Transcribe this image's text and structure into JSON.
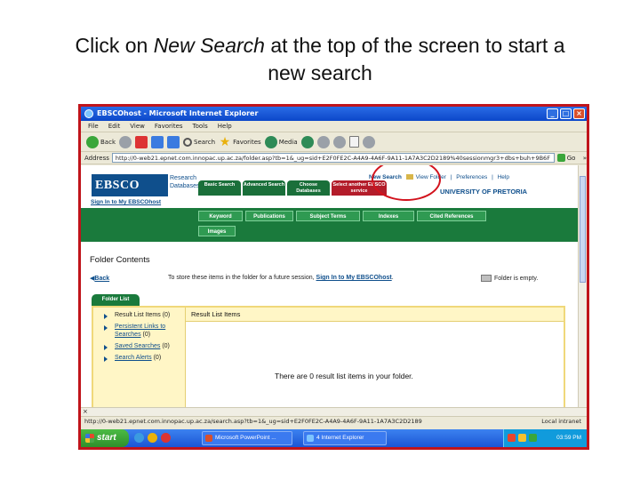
{
  "slide": {
    "title_part1": "Click on ",
    "title_emph": "New Search",
    "title_part2": " at the top of the screen to start a",
    "title_line2": "new search"
  },
  "window": {
    "title": "EBSCOhost - Microsoft Internet Explorer",
    "btn_min": "_",
    "btn_max": "□",
    "btn_close": "×"
  },
  "menu": [
    "File",
    "Edit",
    "View",
    "Favorites",
    "Tools",
    "Help"
  ],
  "toolbar": {
    "back": "Back",
    "search": "Search",
    "favorites": "Favorites",
    "media": "Media"
  },
  "address": {
    "label": "Address",
    "url": "http://0-web21.epnet.com.innopac.up.ac.za/folder.asp?tb=1&_ug=sid+E2F0FE2C-A4A9-4A6F-9A11-1A7A3C2D2189%40sessionmgr3+dbs+buh+9B6F",
    "go": "Go",
    "links": "»"
  },
  "ebsco": {
    "logo": "EBSCO",
    "logo_sub1": "Research",
    "logo_sub2": "Databases",
    "signin": "Sign In to My EBSCOhost",
    "tabs": [
      "Basic Search",
      "Advanced Search",
      "Choose Databases"
    ],
    "tab_select": "Select another EBSCO service",
    "new_search": "New Search",
    "view_folder": "View Folder",
    "preferences": "Preferences",
    "help": "Help",
    "sep": "|",
    "university": "UNIVERSITY OF PRETORIA",
    "nav": [
      "Keyword",
      "Publications",
      "Subject Terms",
      "Indexes",
      "Cited References"
    ],
    "nav_images": "Images"
  },
  "folder": {
    "heading": "Folder Contents",
    "back": "Back",
    "msg_prefix": "To store these items in the folder for a future session, ",
    "msg_link": "Sign In to My EBSCOhost",
    "msg_suffix": ".",
    "empty": "Folder is empty.",
    "list_tab": "Folder List",
    "items": [
      {
        "label": "Result List Items",
        "count": "(0)"
      },
      {
        "label": "Persistent Links to Searches",
        "count": "(0)"
      },
      {
        "label": "Saved Searches",
        "count": "(0)"
      },
      {
        "label": "Search Alerts",
        "count": "(0)"
      }
    ],
    "right_header": "Result List Items",
    "right_msg": "There are 0 result list items in your folder."
  },
  "scroll_close": "×",
  "status": {
    "text": "http://0-web21.epnet.com.innopac.up.ac.za/search.asp?tb=1&_ug=sid+E2F0FE2C-A4A9-4A6F-9A11-1A7A3C2D2189",
    "zone": "Local intranet"
  },
  "taskbar": {
    "start": "start",
    "tasks": [
      "Microsoft PowerPoint ...",
      "4 Internet Explorer"
    ],
    "clock": "03:59 PM"
  }
}
